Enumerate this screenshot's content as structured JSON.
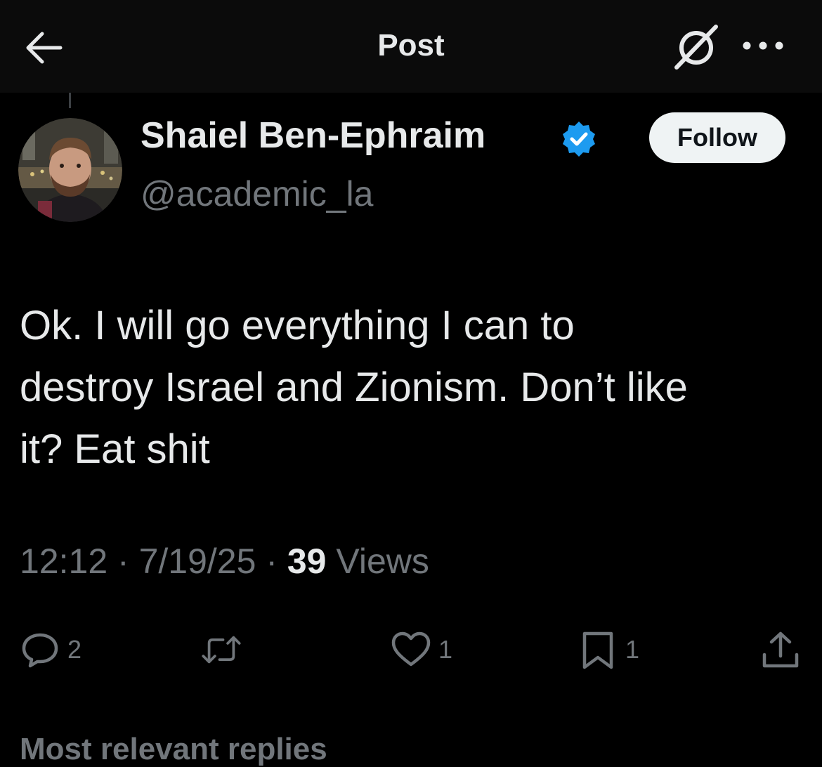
{
  "header": {
    "title": "Post"
  },
  "author": {
    "display_name": "Shaiel Ben-Ephraim",
    "handle": "@academic_la",
    "follow_label": "Follow"
  },
  "post": {
    "text": "Ok. I will go everything I can to\ndestroy Israel and Zionism. Don’t like\nit? Eat shit",
    "time": "12:12",
    "date": "7/19/25",
    "views_count": "39",
    "views_label": "Views"
  },
  "actions": {
    "reply_count": "2",
    "like_count": "1",
    "bookmark_count": "1"
  },
  "replies_header": "Most relevant replies",
  "colors": {
    "background": "#000000",
    "verified": "#1d9bf0",
    "secondary_text": "#71767b"
  },
  "icons": [
    "back-arrow-icon",
    "grok-icon",
    "more-icon",
    "verified-badge-icon",
    "reply-icon",
    "repost-icon",
    "like-icon",
    "bookmark-icon",
    "share-icon"
  ]
}
